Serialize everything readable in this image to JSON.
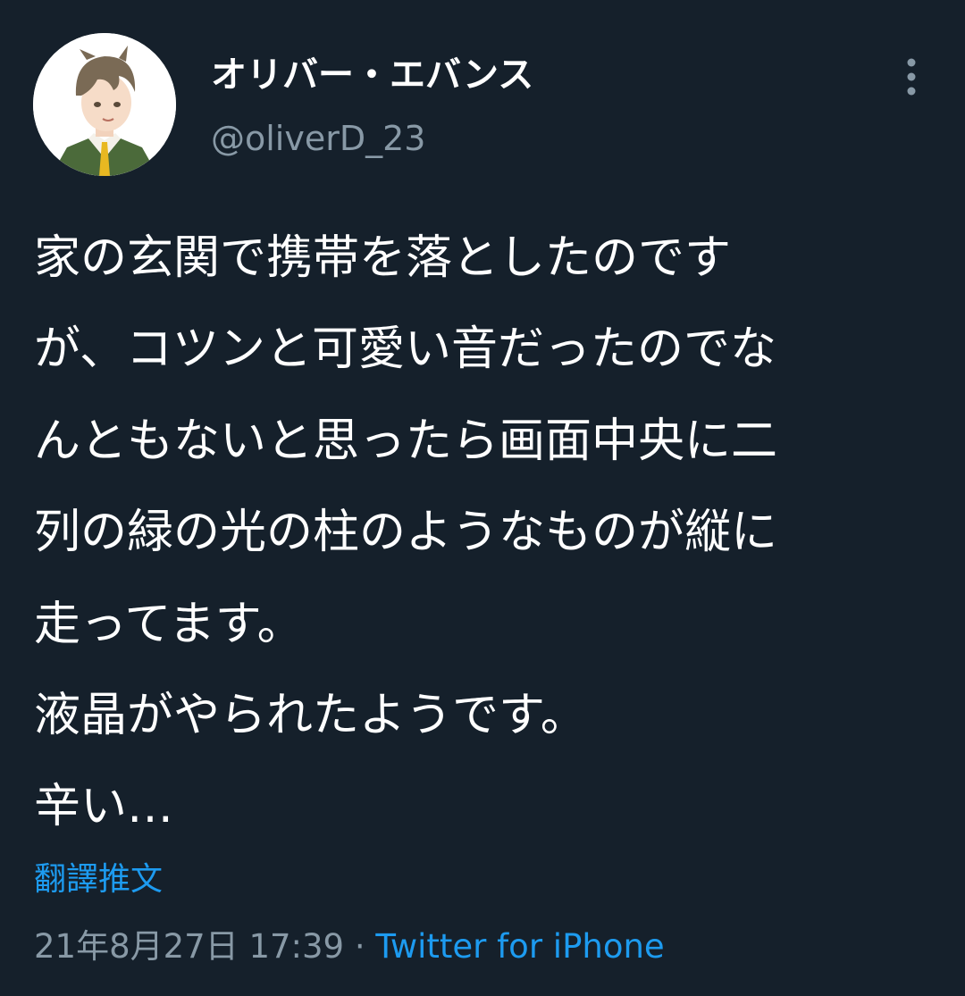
{
  "author": {
    "display_name": "オリバー・エバンス",
    "handle": "@oliverD_23",
    "avatar_icon": "anime-character-avatar"
  },
  "header": {
    "more_icon": "more-vertical-icon"
  },
  "tweet": {
    "text": "家の玄関で携帯を落としたのです\nが、コツンと可愛い音だったのでな\nんともないと思ったら画面中央に二\n列の緑の光の柱のようなものが縦に\n走ってます。\n液晶がやられたようです。\n辛い…",
    "translate_label": "翻譯推文",
    "timestamp": "21年8月27日 17:39",
    "separator": "·",
    "source": "Twitter for iPhone"
  },
  "colors": {
    "background": "#15202b",
    "primary_text": "#ffffff",
    "secondary_text": "#8899a6",
    "link": "#1d9bf0"
  }
}
